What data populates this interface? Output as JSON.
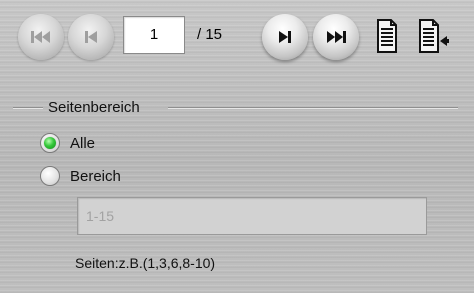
{
  "toolbar": {
    "current_page": "1",
    "total_pages": "/ 15",
    "buttons": {
      "first": {
        "icon": "first-page-icon",
        "enabled": false
      },
      "prev": {
        "icon": "previous-page-icon",
        "enabled": false
      },
      "next": {
        "icon": "next-page-icon",
        "enabled": true
      },
      "last": {
        "icon": "last-page-icon",
        "enabled": true
      }
    },
    "doc_icons": [
      "document-icon",
      "document-export-icon"
    ]
  },
  "page_range": {
    "title": "Seitenbereich",
    "options": [
      {
        "label": "Alle",
        "selected": true
      },
      {
        "label": "Bereich",
        "selected": false
      }
    ],
    "range_value": "1-15",
    "hint": "Seiten:z.B.(1,3,6,8-10)"
  }
}
